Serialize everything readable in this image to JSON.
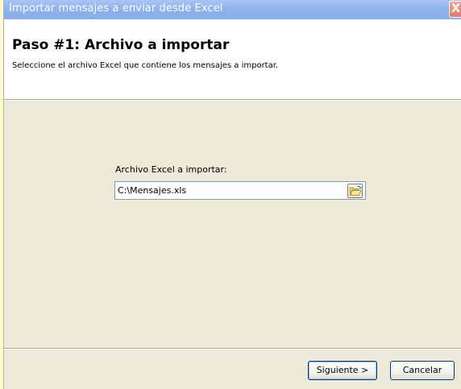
{
  "window": {
    "title": "Importar mensajes a enviar desde Excel",
    "close_label": "X"
  },
  "header": {
    "title": "Paso #1: Archivo a importar",
    "subtitle": "Seleccione el archivo Excel que contiene los mensajes a importar."
  },
  "form": {
    "file_label": "Archivo Excel a importar:",
    "file_value": "C:\\Mensajes.xls"
  },
  "buttons": {
    "next_label": "Siguiente >",
    "cancel_label": "Cancelar"
  },
  "colors": {
    "titlebar": "#8fb2ee",
    "dialog_bg": "#ece9d8",
    "close": "#e27a69"
  }
}
